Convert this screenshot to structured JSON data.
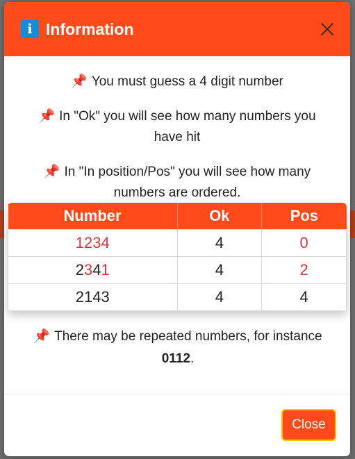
{
  "modal": {
    "title": "Information",
    "info_icon_glyph": "i",
    "close_label": "Close"
  },
  "paragraphs": [
    {
      "pin": "📌",
      "text": "You must guess a 4 digit number"
    },
    {
      "pin": "📌",
      "text": "In \"Ok\" you will see how many numbers you have hit"
    },
    {
      "pin": "📌",
      "text": "In \"In position/Pos\" you will see how many numbers are ordered."
    }
  ],
  "table": {
    "headers": [
      "Number",
      "Ok",
      "Pos"
    ],
    "rows": [
      {
        "digits": [
          "1",
          "2",
          "3",
          "4"
        ],
        "red_digits": [
          true,
          true,
          true,
          true
        ],
        "ok": "4",
        "pos": "0",
        "pos_red": true
      },
      {
        "digits": [
          "2",
          "3",
          "4",
          "1"
        ],
        "red_digits": [
          false,
          true,
          false,
          true
        ],
        "ok": "4",
        "pos": "2",
        "pos_red": true
      },
      {
        "digits": [
          "2",
          "1",
          "4",
          "3"
        ],
        "red_digits": [
          false,
          false,
          false,
          false
        ],
        "ok": "4",
        "pos": "4",
        "pos_red": false
      }
    ]
  },
  "bottom_note": {
    "pin": "📌",
    "text": "There may be repeated numbers, for instance",
    "example": "0112",
    "period": "."
  },
  "colors": {
    "accent": "#ff4a1c",
    "highlight": "#d9363e",
    "info_icon": "#1a8ad6"
  }
}
